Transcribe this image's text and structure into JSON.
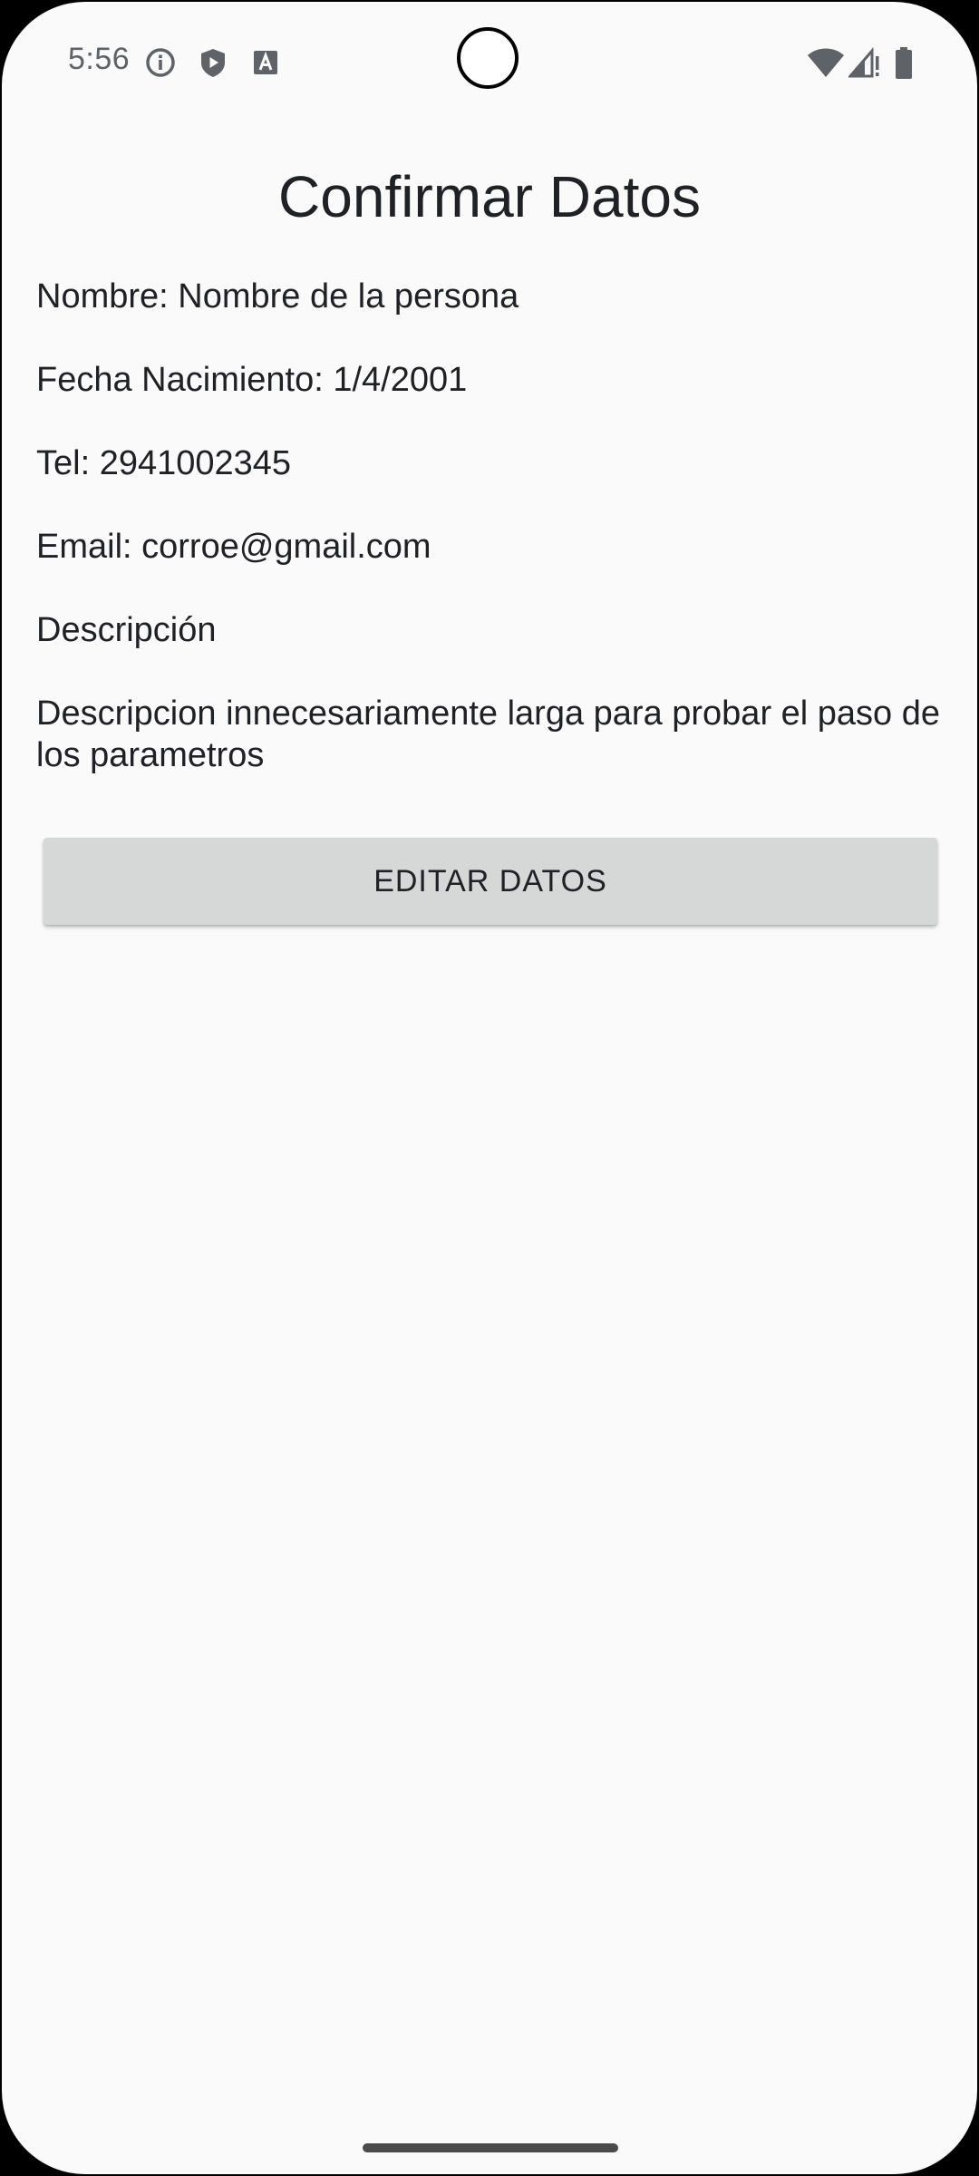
{
  "status_bar": {
    "time": "5:56",
    "left_icons": [
      "info-icon",
      "shield-play-icon",
      "font-a-icon"
    ],
    "right_icons": [
      "wifi-icon",
      "cellular-no-signal-icon",
      "battery-icon"
    ]
  },
  "screen": {
    "title": "Confirmar Datos",
    "fields": [
      {
        "text": "Nombre: Nombre de la persona"
      },
      {
        "text": "Fecha Nacimiento: 1/4/2001"
      },
      {
        "text": "Tel: 2941002345"
      },
      {
        "text": "Email: corroe@gmail.com"
      }
    ],
    "description_label": "Descripción",
    "description_text": "Descripcion innecesariamente larga para probar el paso de los parametros",
    "edit_button_label": "EDITAR DATOS"
  },
  "colors": {
    "background": "#fafafa",
    "text": "#202124",
    "button": "#d6d7d7",
    "status": "#5f6368"
  }
}
